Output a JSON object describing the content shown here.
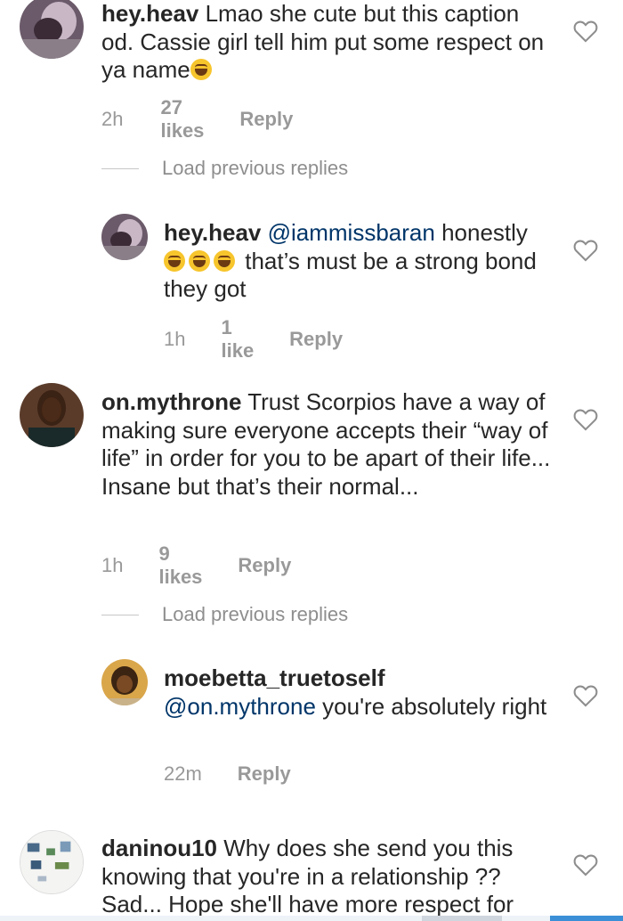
{
  "comments": [
    {
      "username": "hey.heav",
      "text": "Lmao she cute but this caption od. Cassie girl tell him put some respect on ya name",
      "emoji_count": 1,
      "time": "2h",
      "likes": "27 likes",
      "reply": "Reply"
    },
    {
      "username": "hey.heav",
      "mention": "@iammissbaran",
      "text_after_mention": "honestly",
      "emoji_count": 3,
      "text_after_emoji": "that’s must be a strong bond they got",
      "time": "1h",
      "likes": "1 like",
      "reply": "Reply"
    },
    {
      "username": "on.mythrone",
      "text": "Trust Scorpios have a way of making sure everyone accepts their “way of life” in order for you to be apart of their life... Insane but that’s their normal...",
      "time": "1h",
      "likes": "9 likes",
      "reply": "Reply"
    },
    {
      "username": "moebetta_truetoself",
      "mention": "@on.mythrone",
      "text_after_mention": "you're absolutely right",
      "time": "22m",
      "reply": "Reply"
    },
    {
      "username": "daninou10",
      "text": "Why does she send you this knowing that you're in a relationship ?? Sad... Hope she'll have more respect for"
    }
  ],
  "load_previous_replies": "Load previous replies",
  "icons": {
    "like": "heart-outline-icon"
  },
  "colors": {
    "text": "#262626",
    "muted": "#8e8e8e",
    "mention": "#003569",
    "bar_blue": "#3b8fd6"
  }
}
